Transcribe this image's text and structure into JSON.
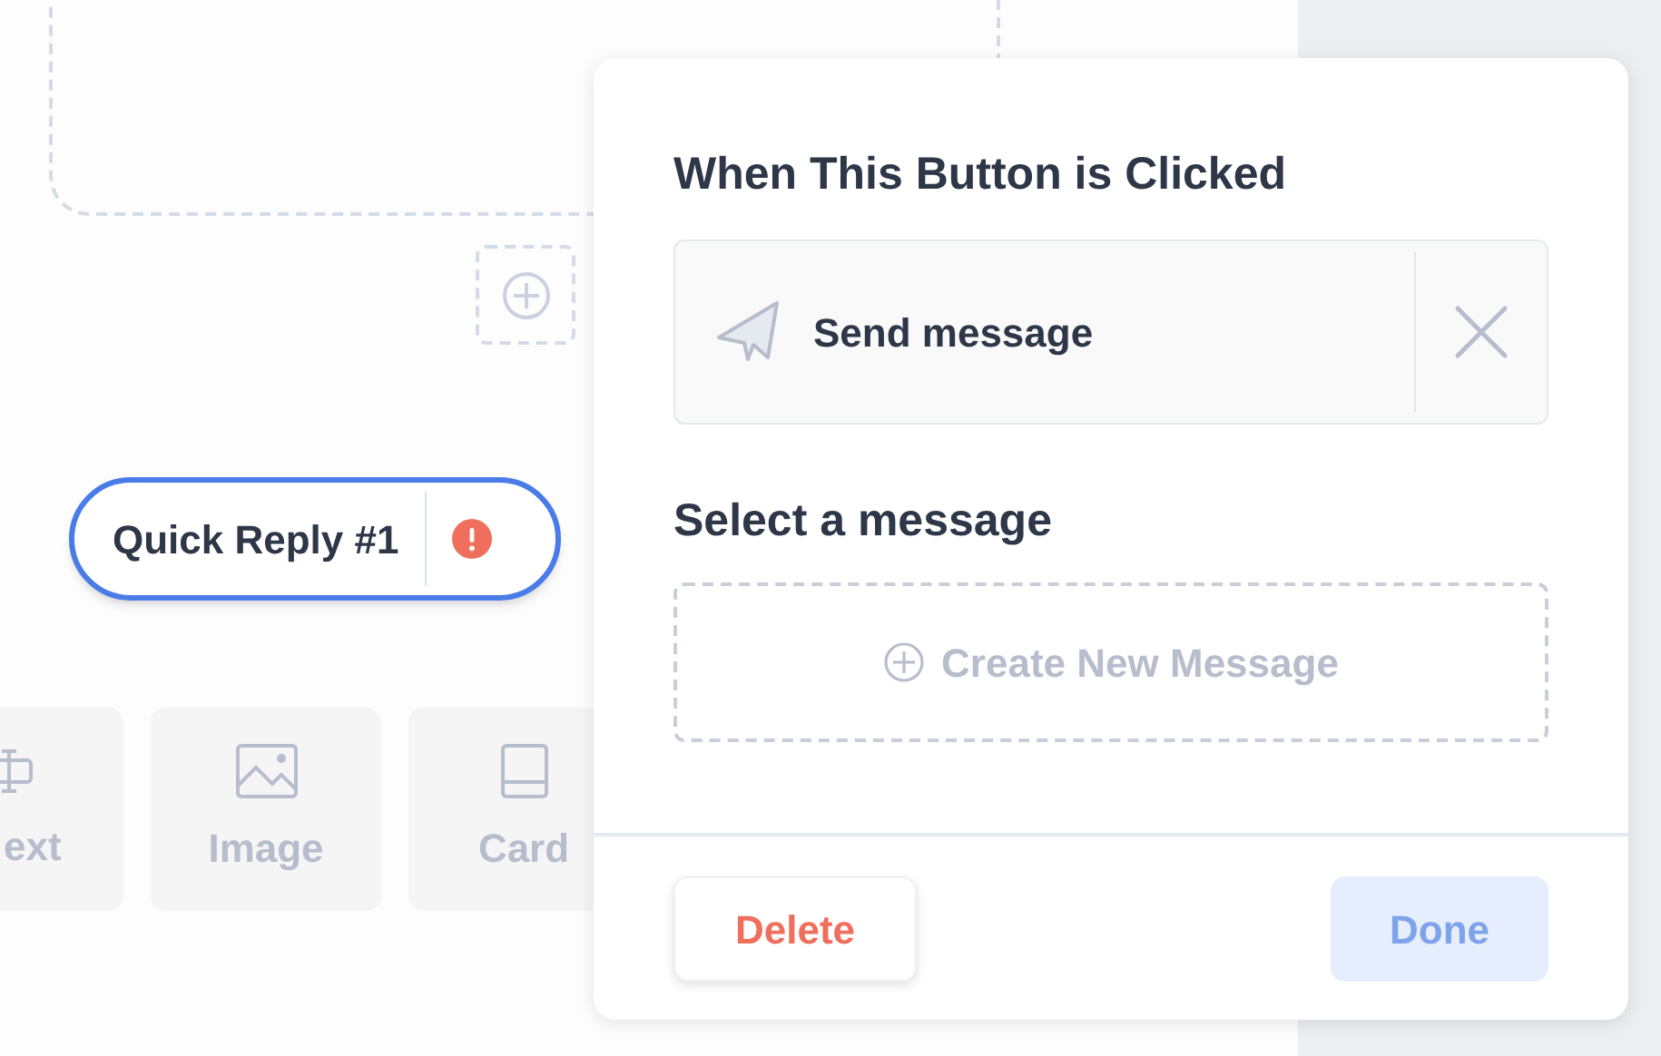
{
  "canvas": {
    "quick_reply": {
      "label": "Quick Reply #1",
      "error": true
    },
    "element_tiles": [
      {
        "label": "ext",
        "kind": "text"
      },
      {
        "label": "Image",
        "kind": "image"
      },
      {
        "label": "Card",
        "kind": "card"
      }
    ]
  },
  "popover": {
    "title": "When This Button is Clicked",
    "action": {
      "label": "Send message"
    },
    "message_section": {
      "title": "Select a message",
      "create_label": "Create New Message"
    },
    "buttons": [
      {
        "label": "Delete",
        "kind": "danger",
        "disabled": false
      },
      {
        "label": "Done",
        "kind": "primary",
        "disabled": true
      }
    ]
  }
}
